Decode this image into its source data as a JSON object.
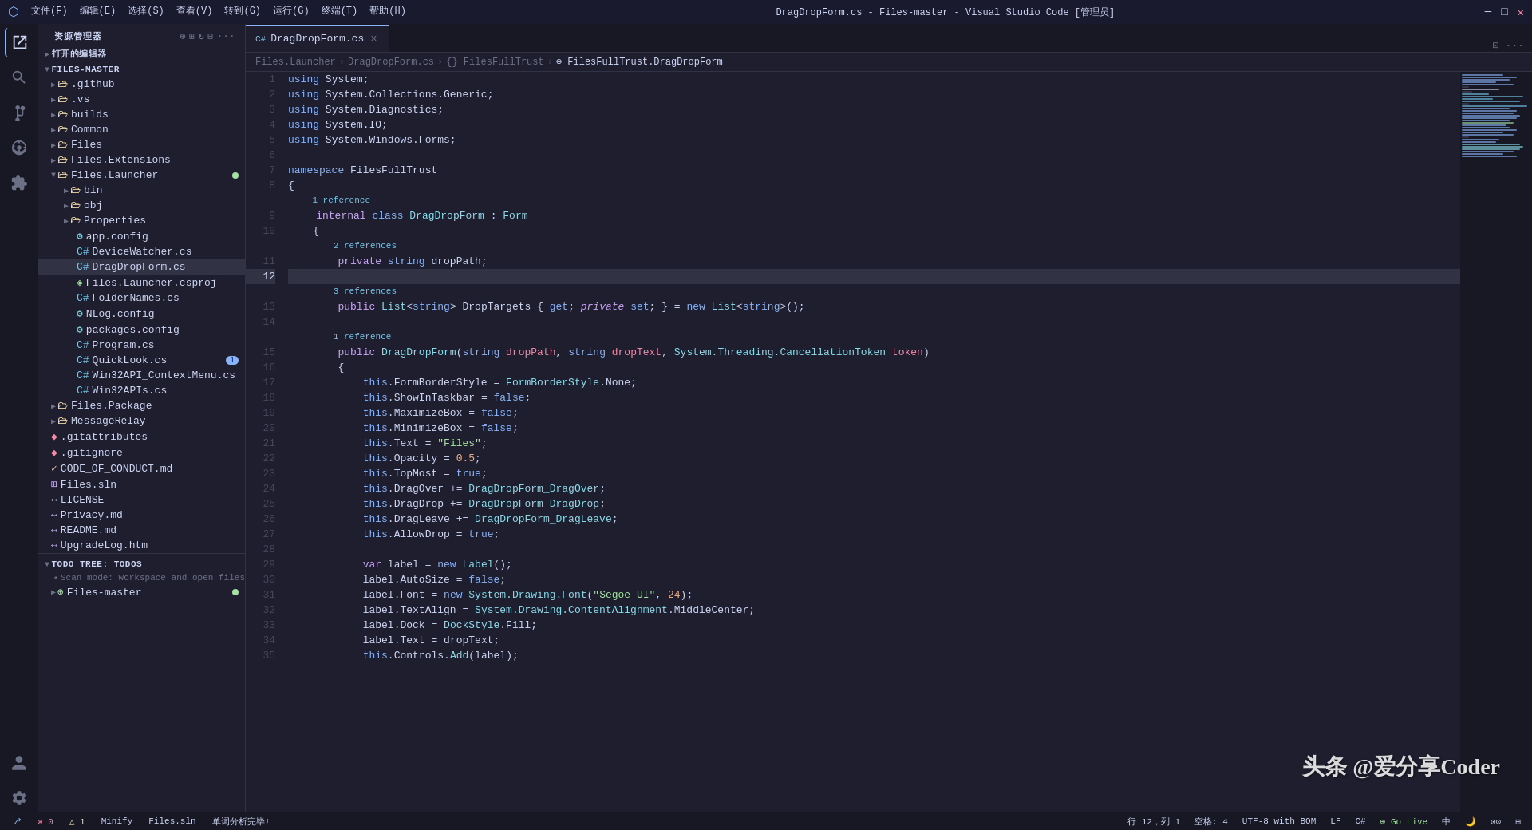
{
  "titleBar": {
    "menu": [
      "文件(F)",
      "编辑(E)",
      "选择(S)",
      "查看(V)",
      "转到(G)",
      "运行(G)",
      "终端(T)",
      "帮助(H)"
    ],
    "title": "DragDropForm.cs - Files-master - Visual Studio Code [管理员]",
    "windowControls": [
      "─",
      "□",
      "✕"
    ]
  },
  "activityBar": {
    "icons": [
      "explorer",
      "search",
      "git",
      "debug",
      "extensions",
      "account",
      "settings"
    ]
  },
  "sidebar": {
    "header": "资源管理器",
    "sections": {
      "openEditors": "打开的编辑器",
      "filesMaster": "FILES-MASTER"
    },
    "tree": [
      {
        "indent": 0,
        "type": "folder",
        "name": ".github",
        "open": false
      },
      {
        "indent": 0,
        "type": "folder",
        "name": ".vs",
        "open": false
      },
      {
        "indent": 0,
        "type": "folder",
        "name": "builds",
        "open": false
      },
      {
        "indent": 0,
        "type": "folder",
        "name": "Common",
        "open": false
      },
      {
        "indent": 0,
        "type": "folder",
        "name": "Files",
        "open": false
      },
      {
        "indent": 0,
        "type": "folder",
        "name": "Files.Extensions",
        "open": false
      },
      {
        "indent": 0,
        "type": "folder",
        "name": "Files.Launcher",
        "open": true,
        "badge": true
      },
      {
        "indent": 1,
        "type": "folder",
        "name": "bin",
        "open": false
      },
      {
        "indent": 1,
        "type": "folder",
        "name": "obj",
        "open": false
      },
      {
        "indent": 1,
        "type": "folder",
        "name": "Properties",
        "open": false
      },
      {
        "indent": 1,
        "type": "config",
        "name": "app.config"
      },
      {
        "indent": 1,
        "type": "cs",
        "name": "DeviceWatcher.cs"
      },
      {
        "indent": 1,
        "type": "cs",
        "name": "DragDropForm.cs",
        "active": true
      },
      {
        "indent": 1,
        "type": "csproj",
        "name": "Files.Launcher.csproj"
      },
      {
        "indent": 1,
        "type": "cs",
        "name": "FolderNames.cs"
      },
      {
        "indent": 1,
        "type": "config",
        "name": "NLog.config"
      },
      {
        "indent": 1,
        "type": "config",
        "name": "packages.config"
      },
      {
        "indent": 1,
        "type": "cs",
        "name": "Program.cs"
      },
      {
        "indent": 1,
        "type": "cs",
        "name": "QuickLook.cs",
        "badge_num": 1
      },
      {
        "indent": 1,
        "type": "cs",
        "name": "Win32API_ContextMenu.cs"
      },
      {
        "indent": 1,
        "type": "cs",
        "name": "Win32APIs.cs"
      },
      {
        "indent": 0,
        "type": "folder",
        "name": "Files.Package",
        "open": false
      },
      {
        "indent": 0,
        "type": "folder",
        "name": "MessageRelay",
        "open": false
      },
      {
        "indent": 0,
        "type": "git",
        "name": ".gitattributes"
      },
      {
        "indent": 0,
        "type": "git",
        "name": ".gitignore"
      },
      {
        "indent": 0,
        "type": "md",
        "name": "CODE_OF_CONDUCT.md"
      },
      {
        "indent": 0,
        "type": "sln",
        "name": "Files.sln"
      },
      {
        "indent": 0,
        "type": "txt",
        "name": "LICENSE"
      },
      {
        "indent": 0,
        "type": "md",
        "name": "Privacy.md"
      },
      {
        "indent": 0,
        "type": "md",
        "name": "README.md"
      },
      {
        "indent": 0,
        "type": "md",
        "name": "UpgradeLog.htm"
      }
    ],
    "todoTree": {
      "header": "TODO TREE: TODOS",
      "scanMode": "Scan mode: workspace and open files",
      "items": [
        "Files-master"
      ]
    }
  },
  "tabs": [
    {
      "label": "DragDropForm.cs",
      "active": true,
      "icon": "cs"
    }
  ],
  "breadcrumb": {
    "items": [
      "Files.Launcher",
      "DragDropForm.cs",
      "{} FilesFullTrust",
      "⊕ FilesFullTrust.DragDropForm"
    ]
  },
  "editor": {
    "filename": "DragDropForm.cs",
    "lines": [
      {
        "num": 1,
        "content": "using System;"
      },
      {
        "num": 2,
        "content": "using System.Collections.Generic;"
      },
      {
        "num": 3,
        "content": "using System.Diagnostics;"
      },
      {
        "num": 4,
        "content": "using System.IO;"
      },
      {
        "num": 5,
        "content": "using System.Windows.Forms;"
      },
      {
        "num": 6,
        "content": ""
      },
      {
        "num": 7,
        "content": "namespace FilesFullTrust"
      },
      {
        "num": 8,
        "content": "{"
      },
      {
        "num": 9,
        "content": "    1 reference\n    internal class DragDropForm : Form"
      },
      {
        "num": 10,
        "content": "    {"
      },
      {
        "num": 11,
        "content": "        2 references\n        private string dropPath;"
      },
      {
        "num": 12,
        "content": ""
      },
      {
        "num": 13,
        "content": "        3 references\n        public List<string> DropTargets { get; private set; } = new List<string>();"
      },
      {
        "num": 14,
        "content": ""
      },
      {
        "num": 15,
        "content": "        1 reference\n        public DragDropForm(string dropPath, string dropText, System.Threading.CancellationToken token)"
      },
      {
        "num": 16,
        "content": "        {"
      },
      {
        "num": 17,
        "content": "            this.FormBorderStyle = FormBorderStyle.None;"
      },
      {
        "num": 18,
        "content": "            this.ShowInTaskbar = false;"
      },
      {
        "num": 19,
        "content": "            this.MaximizeBox = false;"
      },
      {
        "num": 20,
        "content": "            this.MinimizeBox = false;"
      },
      {
        "num": 21,
        "content": "            this.Text = \"Files\";"
      },
      {
        "num": 22,
        "content": "            this.Opacity = 0.5;"
      },
      {
        "num": 23,
        "content": "            this.TopMost = true;"
      },
      {
        "num": 24,
        "content": "            this.DragOver += DragDropForm_DragOver;"
      },
      {
        "num": 25,
        "content": "            this.DragDrop += DragDropForm_DragDrop;"
      },
      {
        "num": 26,
        "content": "            this.DragLeave += DragDropForm_DragLeave;"
      },
      {
        "num": 27,
        "content": "            this.AllowDrop = true;"
      },
      {
        "num": 28,
        "content": ""
      },
      {
        "num": 29,
        "content": "            var label = new Label();"
      },
      {
        "num": 30,
        "content": "            label.AutoSize = false;"
      },
      {
        "num": 31,
        "content": "            label.Font = new System.Drawing.Font(\"Segoe UI\", 24);"
      },
      {
        "num": 32,
        "content": "            label.TextAlign = System.Drawing.ContentAlignment.MiddleCenter;"
      },
      {
        "num": 33,
        "content": "            label.Dock = DockStyle.Fill;"
      },
      {
        "num": 34,
        "content": "            label.Text = dropText;"
      },
      {
        "num": 35,
        "content": "            this.Controls.Add(label);"
      }
    ]
  },
  "statusBar": {
    "left": {
      "errors": "⊗ 0 △ 1",
      "branch": "Minify",
      "sln": "Files.sln",
      "analysis": "单词分析完毕!"
    },
    "right": {
      "position": "行 12，列 1",
      "spaces": "空格: 4",
      "encoding": "UTF-8 with BOM",
      "lineEnding": "LF",
      "language": "C#",
      "goLive": "⊕ Go Live",
      "icons": [
        "中",
        "🌙",
        "⊙⊙"
      ]
    }
  },
  "watermark": "头条 @爱分享Coder"
}
